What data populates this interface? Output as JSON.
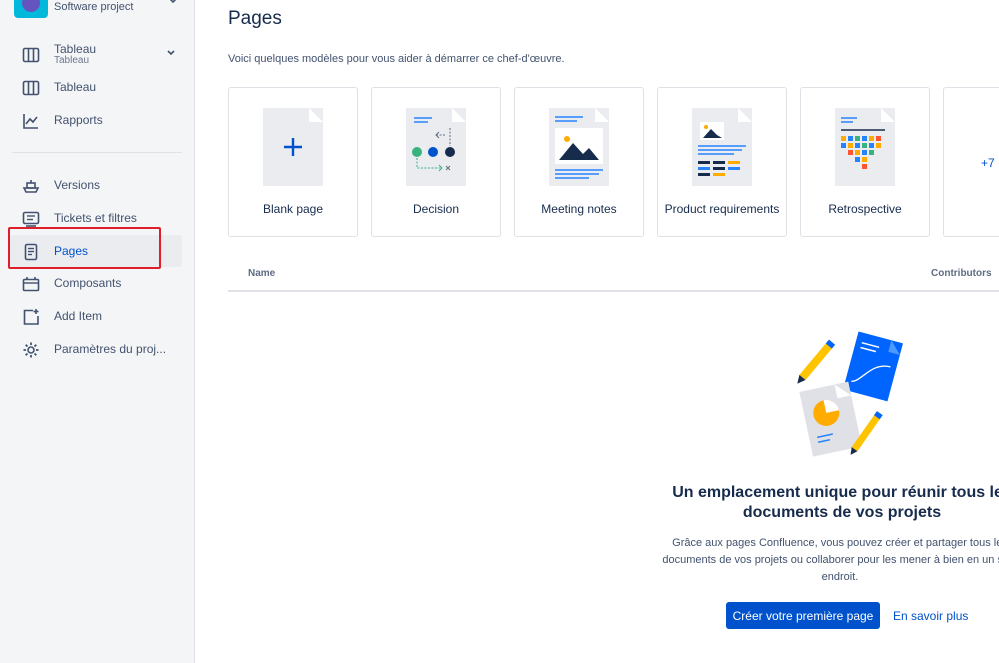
{
  "project": {
    "type": "Software project"
  },
  "sidebar": {
    "board_group": {
      "label": "Tableau",
      "sublabel": "Tableau"
    },
    "items": [
      {
        "label": "Tableau",
        "icon": "board-icon"
      },
      {
        "label": "Rapports",
        "icon": "chart-line-icon"
      },
      {
        "label": "Versions",
        "icon": "ship-icon"
      },
      {
        "label": "Tickets et filtres",
        "icon": "filter-list-icon"
      },
      {
        "label": "Pages",
        "icon": "page-icon"
      },
      {
        "label": "Composants",
        "icon": "component-icon"
      },
      {
        "label": "Add Item",
        "icon": "add-item-icon"
      },
      {
        "label": "Paramètres du proj...",
        "icon": "gear-icon"
      }
    ]
  },
  "main": {
    "title": "Pages",
    "subtitle": "Voici quelques modèles pour vous aider à démarrer ce chef-d'œuvre.",
    "templates": [
      {
        "label": "Blank page"
      },
      {
        "label": "Decision"
      },
      {
        "label": "Meeting notes"
      },
      {
        "label": "Product requirements"
      },
      {
        "label": "Retrospective"
      }
    ],
    "more_label": "+7",
    "table": {
      "col_name": "Name",
      "col_contributors": "Contributors"
    },
    "empty_state": {
      "title": "Un emplacement unique pour réunir tous les documents de vos projets",
      "description": "Grâce aux pages Confluence, vous pouvez créer et partager tous les documents de vos projets ou collaborer pour les mener à bien en un seul endroit.",
      "primary_button": "Créer votre première page",
      "link": "En savoir plus"
    }
  },
  "colors": {
    "accent": "#0052cc",
    "highlight": "#e01e2b",
    "sidebar_bg": "#f4f5f7"
  }
}
